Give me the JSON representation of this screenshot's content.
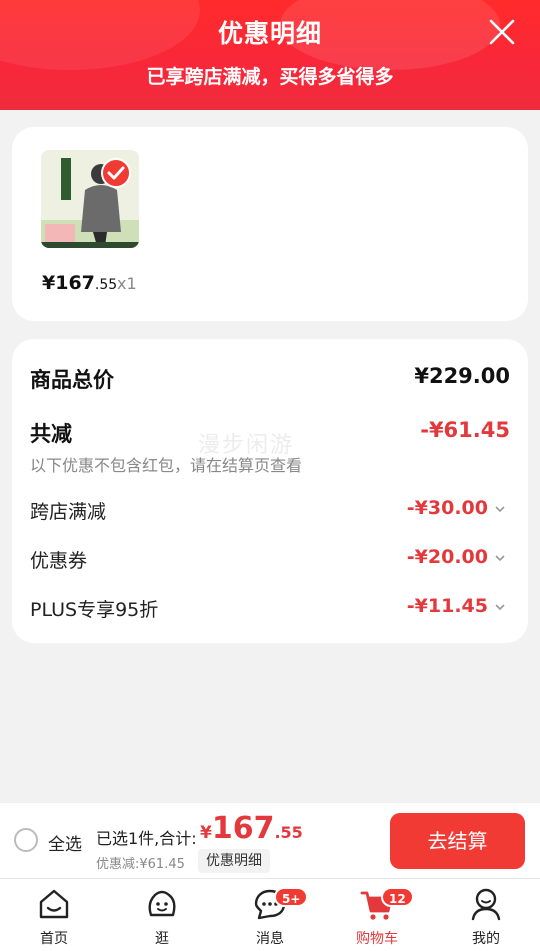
{
  "header": {
    "title": "优惠明细",
    "subtitle": "已享跨店满减，买得多省得多"
  },
  "product": {
    "price_symbol": "¥",
    "price_int": "167",
    "price_dec": ".55",
    "quantity": "x1",
    "selected": true
  },
  "summary": {
    "total_label": "商品总价",
    "total_value": "¥229.00",
    "reduce_label": "共减",
    "reduce_value": "-¥61.45",
    "note": "以下优惠不包含红包，请在结算页查看",
    "items": [
      {
        "label": "跨店满减",
        "value": "-¥30.00"
      },
      {
        "label": "优惠券",
        "value": "-¥20.00"
      },
      {
        "label": "PLUS专享95折",
        "value": "-¥11.45"
      }
    ],
    "watermark": "漫步闲游"
  },
  "bottom_bar": {
    "select_all": "全选",
    "selected_text": "已选1件,合计:",
    "total_symbol": "¥",
    "total_int": "167",
    "total_dec": ".55",
    "discount_text": "优惠减:¥61.45",
    "detail_button": "优惠明细",
    "checkout_button": "去结算"
  },
  "tabbar": {
    "tabs": [
      {
        "label": "首页",
        "icon": "home-icon"
      },
      {
        "label": "逛",
        "icon": "face-icon"
      },
      {
        "label": "消息",
        "icon": "message-icon",
        "badge": "5+"
      },
      {
        "label": "购物车",
        "icon": "cart-icon",
        "badge": "12",
        "active": true
      },
      {
        "label": "我的",
        "icon": "profile-icon"
      }
    ]
  },
  "colors": {
    "accent": "#e4393c",
    "header_red": "#f8283a",
    "background": "#f2f2f2"
  }
}
